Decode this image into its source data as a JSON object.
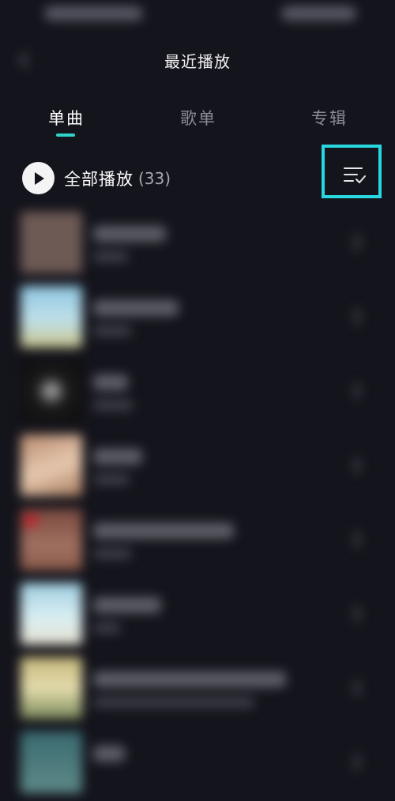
{
  "header": {
    "title": "最近播放"
  },
  "tabs": [
    {
      "label": "单曲",
      "active": true
    },
    {
      "label": "歌单",
      "active": false
    },
    {
      "label": "专辑",
      "active": false
    }
  ],
  "play_all": {
    "label": "全部播放",
    "count": "(33)"
  },
  "icons": {
    "back": "chevron-left-icon",
    "play": "play-icon",
    "sort": "list-check-icon"
  },
  "colors": {
    "background": "#14141c",
    "accent": "#2fd3c9",
    "highlight": "#27d8e1"
  },
  "songs": [
    {
      "cover_color": "#6e5a55"
    },
    {
      "cover_color": "#8fc6e0"
    },
    {
      "cover_color": "#1a1a1a"
    },
    {
      "cover_color": "#b88a6e"
    },
    {
      "cover_color": "#7a4a40"
    },
    {
      "cover_color": "#9fcde0"
    },
    {
      "cover_color": "#c6b77a"
    },
    {
      "cover_color": "#3a6a70"
    }
  ]
}
